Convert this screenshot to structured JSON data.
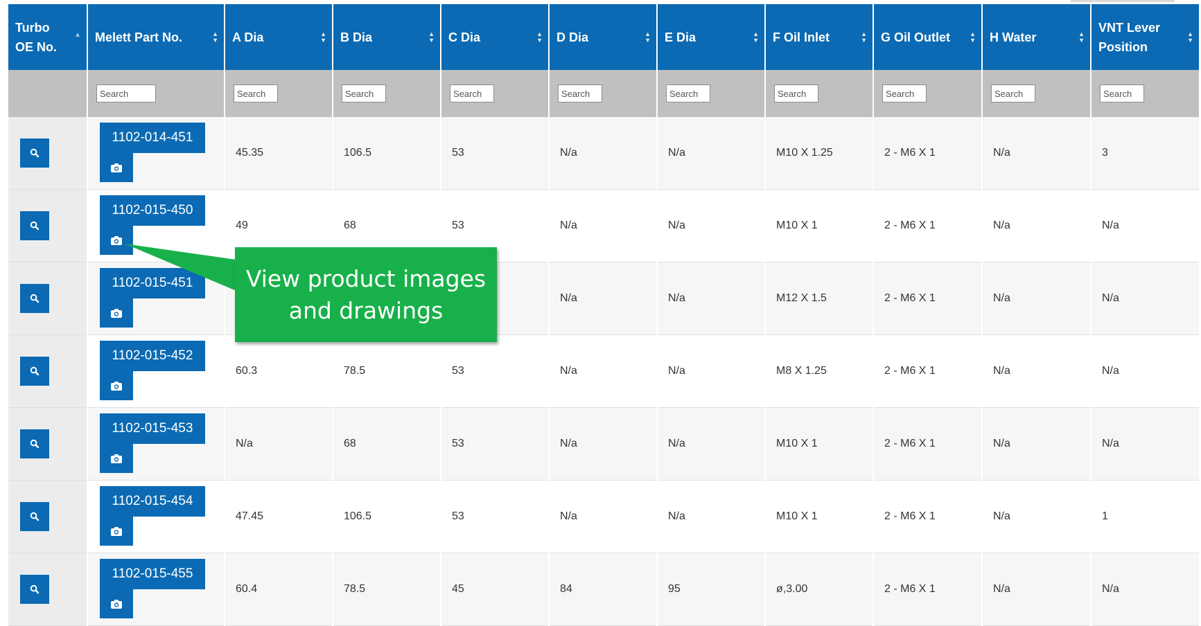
{
  "table": {
    "columns": [
      {
        "label": "Turbo OE No.",
        "sort": "asc"
      },
      {
        "label": "Melett Part No.",
        "sort": "both"
      },
      {
        "label": "A Dia",
        "sort": "both"
      },
      {
        "label": "B Dia",
        "sort": "both"
      },
      {
        "label": "C Dia",
        "sort": "both"
      },
      {
        "label": "D Dia",
        "sort": "both"
      },
      {
        "label": "E Dia",
        "sort": "both"
      },
      {
        "label": "F Oil Inlet",
        "sort": "both"
      },
      {
        "label": "G Oil Outlet",
        "sort": "both"
      },
      {
        "label": "H Water",
        "sort": "both"
      },
      {
        "label": "VNT Lever Position",
        "sort": "both"
      }
    ],
    "search_placeholder": "Search",
    "rows": [
      {
        "part": "1102-014-451",
        "a": "45.35",
        "b": "106.5",
        "c": "53",
        "d": "N/a",
        "e": "N/a",
        "f": "M10 X 1.25",
        "g": "2 - M6 X 1",
        "h": "N/a",
        "vnt": "3"
      },
      {
        "part": "1102-015-450",
        "a": "49",
        "b": "68",
        "c": "53",
        "d": "N/a",
        "e": "N/a",
        "f": "M10 X 1",
        "g": "2 - M6 X 1",
        "h": "N/a",
        "vnt": "N/a"
      },
      {
        "part": "1102-015-451",
        "a": "",
        "b": "",
        "c": "",
        "d": "N/a",
        "e": "N/a",
        "f": "M12 X 1.5",
        "g": "2 - M6 X 1",
        "h": "N/a",
        "vnt": "N/a"
      },
      {
        "part": "1102-015-452",
        "a": "60.3",
        "b": "78.5",
        "c": "53",
        "d": "N/a",
        "e": "N/a",
        "f": "M8 X 1.25",
        "g": "2 - M6 X 1",
        "h": "N/a",
        "vnt": "N/a"
      },
      {
        "part": "1102-015-453",
        "a": "N/a",
        "b": "68",
        "c": "53",
        "d": "N/a",
        "e": "N/a",
        "f": "M10 X 1",
        "g": "2 - M6 X 1",
        "h": "N/a",
        "vnt": "N/a"
      },
      {
        "part": "1102-015-454",
        "a": "47.45",
        "b": "106.5",
        "c": "53",
        "d": "N/a",
        "e": "N/a",
        "f": "M10 X 1",
        "g": "2 - M6 X 1",
        "h": "N/a",
        "vnt": "1"
      },
      {
        "part": "1102-015-455",
        "a": "60.4",
        "b": "78.5",
        "c": "45",
        "d": "84",
        "e": "95",
        "f": "ø,3.00",
        "g": "2 - M6 X 1",
        "h": "N/a",
        "vnt": "N/a"
      }
    ]
  },
  "callout": {
    "line1": "View product images",
    "line2": "and drawings"
  },
  "icons": {
    "view": "magnifier-icon",
    "images": "camera-icon",
    "sort": "sort-arrows-icon"
  },
  "colors": {
    "header_bg": "#0b6ab3",
    "search_row_bg": "#c0c0c0",
    "button_bg": "#0b6ab3",
    "callout_bg": "#18b04a"
  }
}
